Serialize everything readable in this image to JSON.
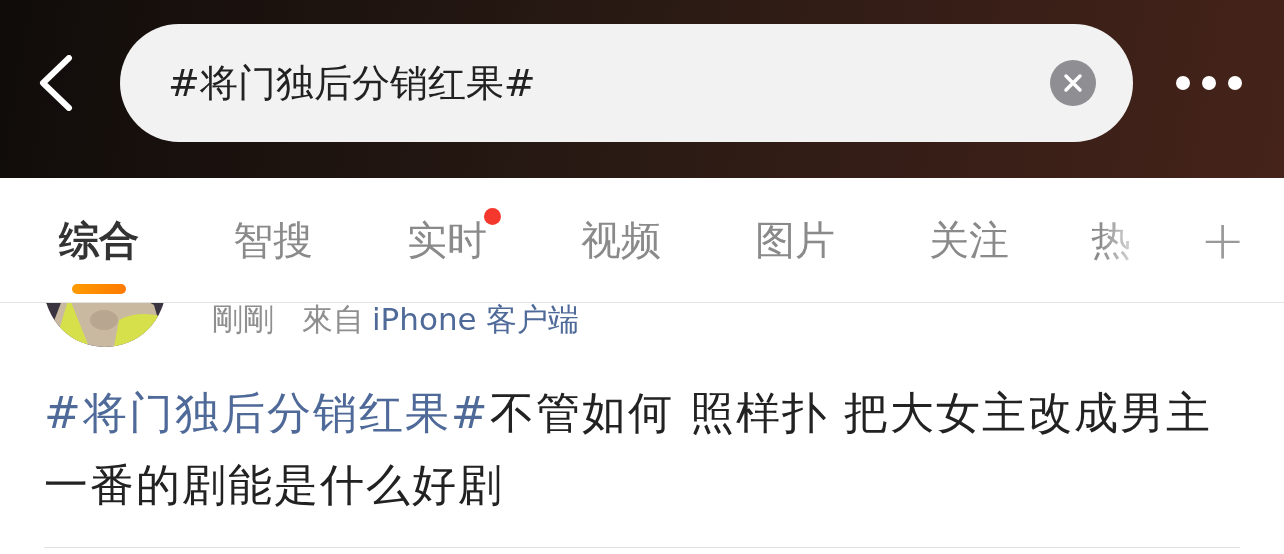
{
  "search": {
    "value": "#将门独后分销红果#"
  },
  "tabs": [
    {
      "label": "综合",
      "selected": true,
      "badge": false
    },
    {
      "label": "智搜",
      "selected": false,
      "badge": false
    },
    {
      "label": "实时",
      "selected": false,
      "badge": true
    },
    {
      "label": "视频",
      "selected": false,
      "badge": false
    },
    {
      "label": "图片",
      "selected": false,
      "badge": false
    },
    {
      "label": "关注",
      "selected": false,
      "badge": false
    },
    {
      "label": "热",
      "selected": false,
      "badge": false
    }
  ],
  "add_tab": "+",
  "post": {
    "time": "剛剛",
    "source_prefix": "來自",
    "source": "iPhone 客户端",
    "hashtag": "#将门独后分销红果#",
    "text": "不管如何 照样扑 把大女主改成男主一番的剧能是什么好剧"
  }
}
